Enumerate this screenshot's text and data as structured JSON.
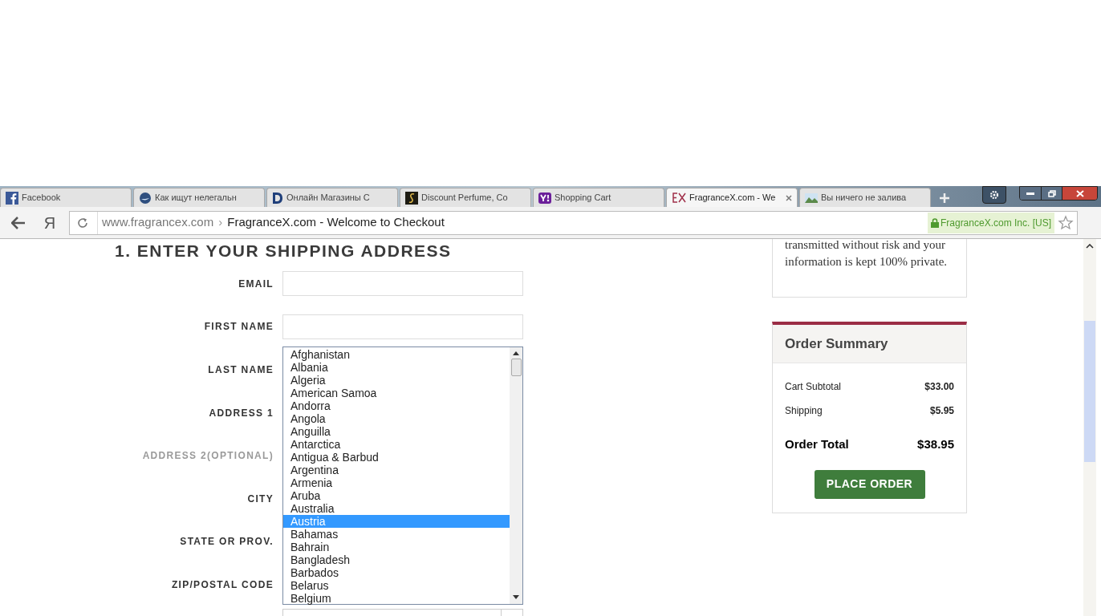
{
  "browser": {
    "tabs": [
      {
        "title": "Facebook",
        "selected": false
      },
      {
        "title": "Как ищут нелегальн",
        "selected": false
      },
      {
        "title": "Онлайн Магазины С",
        "selected": false
      },
      {
        "title": "Discount Perfume, Co",
        "selected": false
      },
      {
        "title": "Shopping Cart",
        "selected": false
      },
      {
        "title": "FragranceX.com - We",
        "selected": true
      },
      {
        "title": "Вы ничего не залива",
        "selected": false
      }
    ],
    "yandex_button": "Я",
    "address": {
      "host": "www.fragrancex.com",
      "separator": "›",
      "page_title": "FragranceX.com - Welcome to Checkout",
      "identity": "FragranceX.com Inc. [US]"
    }
  },
  "form": {
    "heading": "1. ENTER YOUR SHIPPING ADDRESS",
    "fields": [
      {
        "label": "EMAIL",
        "kind": "text",
        "optional": false
      },
      {
        "label": "FIRST NAME",
        "kind": "text",
        "optional": false
      },
      {
        "label": "LAST NAME",
        "kind": "covered",
        "optional": false
      },
      {
        "label": "ADDRESS 1",
        "kind": "covered",
        "optional": false
      },
      {
        "label": "ADDRESS 2(OPTIONAL)",
        "kind": "covered",
        "optional": true
      },
      {
        "label": "CITY",
        "kind": "covered",
        "optional": false
      },
      {
        "label": "STATE OR PROV.",
        "kind": "covered",
        "optional": false
      },
      {
        "label": "ZIP/POSTAL CODE",
        "kind": "covered",
        "optional": false
      }
    ],
    "country_list": [
      {
        "label": "Afghanistan",
        "selected": false
      },
      {
        "label": "Albania",
        "selected": false
      },
      {
        "label": "Algeria",
        "selected": false
      },
      {
        "label": "American Samoa",
        "selected": false
      },
      {
        "label": "Andorra",
        "selected": false
      },
      {
        "label": "Angola",
        "selected": false
      },
      {
        "label": "Anguilla",
        "selected": false
      },
      {
        "label": "Antarctica",
        "selected": false
      },
      {
        "label": "Antigua & Barbud",
        "selected": false
      },
      {
        "label": "Argentina",
        "selected": false
      },
      {
        "label": "Armenia",
        "selected": false
      },
      {
        "label": "Aruba",
        "selected": false
      },
      {
        "label": "Australia",
        "selected": false
      },
      {
        "label": "Austria",
        "selected": true
      },
      {
        "label": "Bahamas",
        "selected": false
      },
      {
        "label": "Bahrain",
        "selected": false
      },
      {
        "label": "Bangladesh",
        "selected": false
      },
      {
        "label": "Barbados",
        "selected": false
      },
      {
        "label": "Belarus",
        "selected": false
      },
      {
        "label": "Belgium",
        "selected": false
      }
    ]
  },
  "sidebar": {
    "security_text": "transmitted without risk and your information is kept 100% private.",
    "order_summary": {
      "title": "Order Summary",
      "lines": [
        {
          "label": "Cart Subtotal",
          "value": "$33.00"
        },
        {
          "label": "Shipping",
          "value": "$5.95"
        }
      ],
      "total": {
        "label": "Order Total",
        "value": "$38.95"
      },
      "button": "PLACE ORDER"
    }
  }
}
